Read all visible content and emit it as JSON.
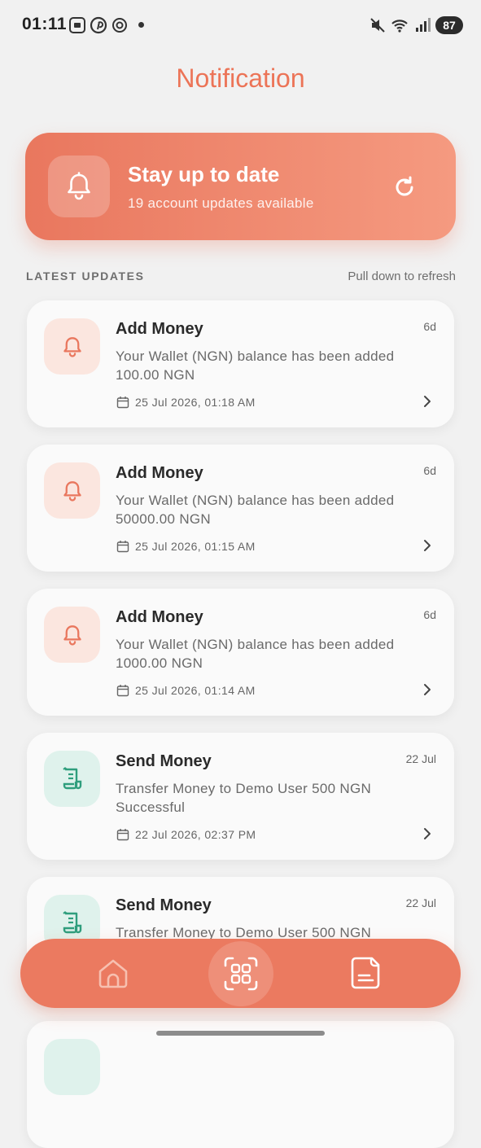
{
  "status_bar": {
    "time": "01:11",
    "battery": "87"
  },
  "page": {
    "title": "Notification"
  },
  "hero": {
    "title": "Stay up to date",
    "subtitle": "19 account updates available",
    "icon": "bell-icon",
    "action_icon": "refresh-icon"
  },
  "section": {
    "heading": "LATEST UPDATES",
    "hint": "Pull down to refresh"
  },
  "notifications": [
    {
      "title": "Add Money",
      "time": "6d",
      "message": "Your Wallet (NGN)  balance  has been added 100.00 NGN",
      "date": "25 Jul 2026, 01:18 AM",
      "icon": "bell-icon",
      "tone": "orange"
    },
    {
      "title": "Add Money",
      "time": "6d",
      "message": "Your Wallet (NGN)  balance  has been added 50000.00 NGN",
      "date": "25 Jul 2026, 01:15 AM",
      "icon": "bell-icon",
      "tone": "orange"
    },
    {
      "title": "Add Money",
      "time": "6d",
      "message": "Your Wallet (NGN)  balance  has been added 1000.00 NGN",
      "date": "25 Jul 2026, 01:14 AM",
      "icon": "bell-icon",
      "tone": "orange"
    },
    {
      "title": "Send Money",
      "time": "22 Jul",
      "message": "Transfer Money to Demo User 500 NGN Successful",
      "date": "22 Jul 2026, 02:37 PM",
      "icon": "receipt-icon",
      "tone": "green"
    },
    {
      "title": "Send Money",
      "time": "22 Jul",
      "message": "Transfer Money to Demo User 500 NGN",
      "date": "",
      "icon": "receipt-icon",
      "tone": "green"
    }
  ],
  "bottom_nav": {
    "items": [
      "home-icon",
      "scan-icon",
      "document-icon"
    ]
  },
  "colors": {
    "accent": "#eb7a60",
    "accent_light": "#f59a80",
    "green_icon": "#2f9e7d",
    "green_bg": "#dff2ec",
    "orange_bg": "#fbe6df",
    "background": "#f1f1f1"
  }
}
